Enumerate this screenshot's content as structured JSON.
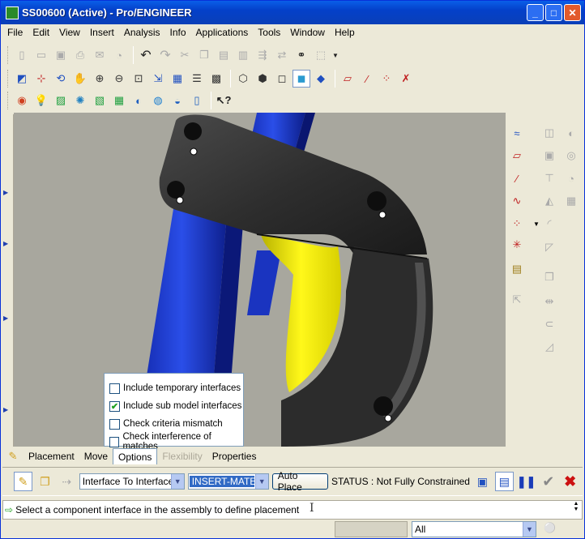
{
  "window": {
    "title": "SS00600 (Active) - Pro/ENGINEER",
    "controls": [
      "_",
      "□",
      "✕"
    ]
  },
  "menubar": {
    "items": [
      "File",
      "Edit",
      "View",
      "Insert",
      "Analysis",
      "Info",
      "Applications",
      "Tools",
      "Window",
      "Help"
    ]
  },
  "options_panel": {
    "items": [
      {
        "label": "Include temporary interfaces",
        "checked": false
      },
      {
        "label": "Include sub model interfaces",
        "checked": true
      },
      {
        "label": "Check criteria mismatch",
        "checked": false
      },
      {
        "label": "Check interference of matches",
        "checked": false
      }
    ]
  },
  "dashboard": {
    "tabs": [
      {
        "label": "Placement",
        "state": "normal"
      },
      {
        "label": "Move",
        "state": "normal"
      },
      {
        "label": "Options",
        "state": "selected"
      },
      {
        "label": "Flexibility",
        "state": "disabled"
      },
      {
        "label": "Properties",
        "state": "normal"
      }
    ],
    "interface_select": "Interface To Interface",
    "constraint_select": "INSERT-MATE",
    "auto_place_label": "Auto Place",
    "status": "STATUS : Not Fully Constrained"
  },
  "message": {
    "text": "Select a component interface in the assembly to define placement"
  },
  "bottom": {
    "filter_value": "All"
  },
  "colors": {
    "titlebar": "#0a4fd8",
    "background": "#a8a79e",
    "part_dark": "#2a2a2a",
    "beam_blue": "#1c3ccf",
    "yellow_part": "#f5ee0a",
    "cancel_red": "#cc1111",
    "accept_grey": "#888888"
  }
}
